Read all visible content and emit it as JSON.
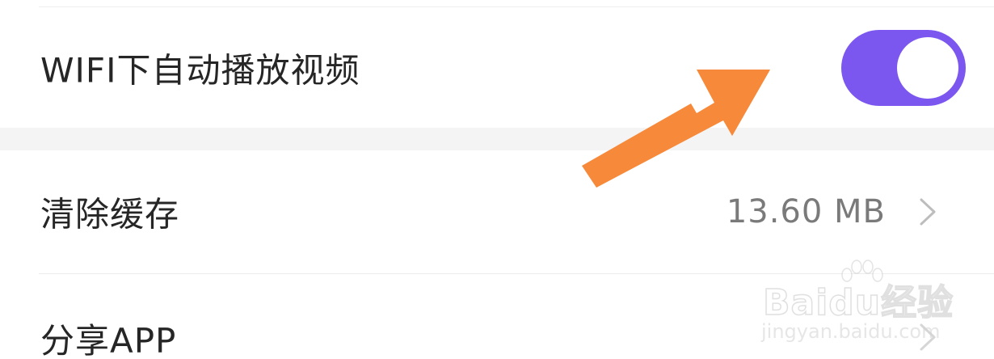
{
  "settings": {
    "autoplay_label": "WIFI下自动播放视频",
    "autoplay_enabled": true,
    "clear_cache_label": "清除缓存",
    "cache_size": "13.60 MB",
    "share_label": "分享APP"
  },
  "watermark": {
    "brand": "Baidu经验",
    "url": "jingyan.baidu.com"
  },
  "icons": {
    "chevron": "chevron-right-icon",
    "arrow": "orange-pointer-arrow"
  },
  "colors": {
    "toggle_on": "#7b57f0",
    "arrow": "#f68a3a",
    "text_primary": "#262626",
    "text_secondary": "#7a7a7a"
  }
}
